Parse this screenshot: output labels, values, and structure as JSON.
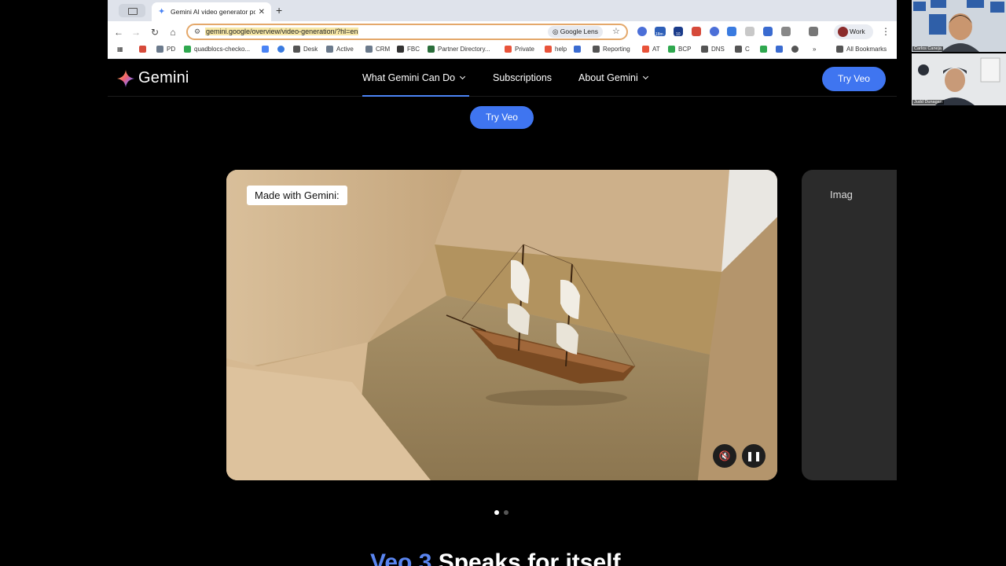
{
  "browser": {
    "tab_title": "Gemini AI video generator po",
    "url": "gemini.google/overview/video-generation/?hl=en",
    "lens_label": "Google Lens",
    "profile_label": "Work",
    "badge_18m": "18m",
    "badge_10": "10"
  },
  "bookmarks": [
    {
      "label": "PD",
      "color": "#6b7a8c"
    },
    {
      "label": "quadblocs-checko...",
      "color": "#2fa84f"
    },
    {
      "label": "Desk",
      "color": "#555555"
    },
    {
      "label": "Active",
      "color": "#6b7a8c"
    },
    {
      "label": "CRM",
      "color": "#6b7a8c"
    },
    {
      "label": "FBC",
      "color": "#333333"
    },
    {
      "label": "Partner Directory...",
      "color": "#2a6e3b"
    },
    {
      "label": "Private",
      "color": "#e8533a"
    },
    {
      "label": "help",
      "color": "#e8533a"
    },
    {
      "label": "Reporting",
      "color": "#555555"
    },
    {
      "label": "AT",
      "color": "#e8533a"
    },
    {
      "label": "BCP",
      "color": "#2fa84f"
    },
    {
      "label": "DNS",
      "color": "#555555"
    },
    {
      "label": "C",
      "color": "#555555"
    },
    {
      "label": "All Bookmarks",
      "color": "#555555"
    }
  ],
  "site": {
    "logo": "Gemini",
    "nav": [
      "What Gemini Can Do",
      "Subscriptions",
      "About Gemini"
    ],
    "try_top": "Try Veo",
    "try_mid": "Try Veo",
    "video_label": "Made with Gemini:",
    "next_card_label": "Imag",
    "headline_accent": "Veo 3",
    "headline_rest": " Speaks for itself"
  },
  "call": {
    "participant1": "Carlos Caneja",
    "participant2": "Judd Dunagan"
  },
  "colors": {
    "accent": "#3f75f0",
    "page_bg": "#000000"
  }
}
